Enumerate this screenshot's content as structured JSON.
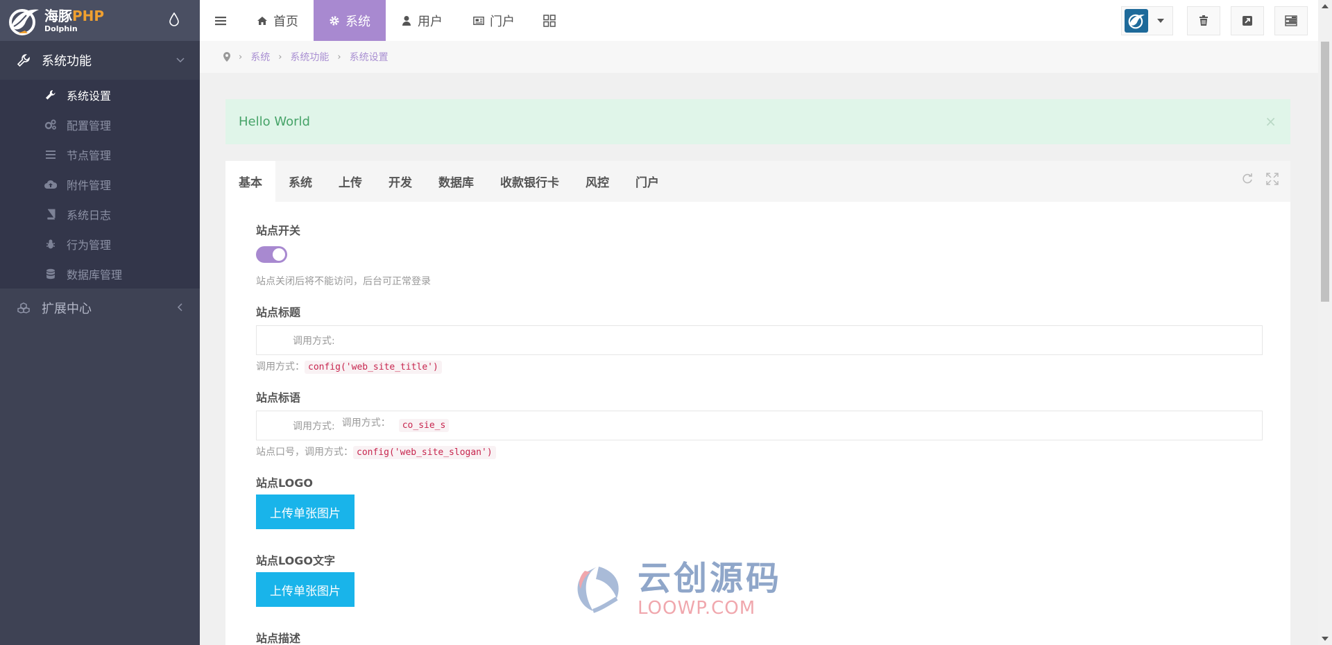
{
  "brand": {
    "name_cn": "海豚",
    "name_php": "PHP",
    "name_en": "Dolphin"
  },
  "sidebar": {
    "groups": [
      {
        "label": "系统功能",
        "items": [
          {
            "label": "系统设置",
            "icon": "wrench-icon"
          },
          {
            "label": "配置管理",
            "icon": "cogs-icon"
          },
          {
            "label": "节点管理",
            "icon": "list-icon"
          },
          {
            "label": "附件管理",
            "icon": "cloud-upload-icon"
          },
          {
            "label": "系统日志",
            "icon": "book-icon"
          },
          {
            "label": "行为管理",
            "icon": "bug-icon"
          },
          {
            "label": "数据库管理",
            "icon": "database-icon"
          }
        ]
      },
      {
        "label": "扩展中心",
        "items": []
      }
    ]
  },
  "topnav": {
    "items": [
      {
        "label": "首页",
        "icon": "home-icon"
      },
      {
        "label": "系统",
        "icon": "gear-icon"
      },
      {
        "label": "用户",
        "icon": "user-icon"
      },
      {
        "label": "门户",
        "icon": "newspaper-icon"
      }
    ]
  },
  "breadcrumb": [
    "系统",
    "系统功能",
    "系统设置"
  ],
  "alert": {
    "text": "Hello World",
    "close": "×"
  },
  "tabs": [
    "基本",
    "系统",
    "上传",
    "开发",
    "数据库",
    "收款银行卡",
    "风控",
    "门户"
  ],
  "form": {
    "site_switch": {
      "label": "站点开关",
      "help": "站点关闭后将不能访问，后台可正常登录"
    },
    "site_title": {
      "label": "站点标题",
      "input_text": "调用方式:",
      "help_prefix": "调用方式：",
      "code": "config('web_site_title')"
    },
    "site_slogan": {
      "label": "站点标语",
      "input_text": "调用方式:",
      "input_text_2": "调用方式：",
      "input_code": "co_sie_s",
      "help_prefix": "站点口号，调用方式：",
      "code": "config('web_site_slogan')"
    },
    "site_logo": {
      "label": "站点LOGO",
      "button": "上传单张图片"
    },
    "site_logo_text": {
      "label": "站点LOGO文字",
      "button": "上传单张图片"
    },
    "site_desc": {
      "label": "站点描述"
    }
  },
  "watermark": {
    "cn": "云创源码",
    "en": "LOOWP.COM"
  },
  "colors": {
    "accent": "#a889d0",
    "upload": "#19b4ea",
    "alert_bg": "#e0f5e9",
    "sidebar": "#3e4254"
  }
}
